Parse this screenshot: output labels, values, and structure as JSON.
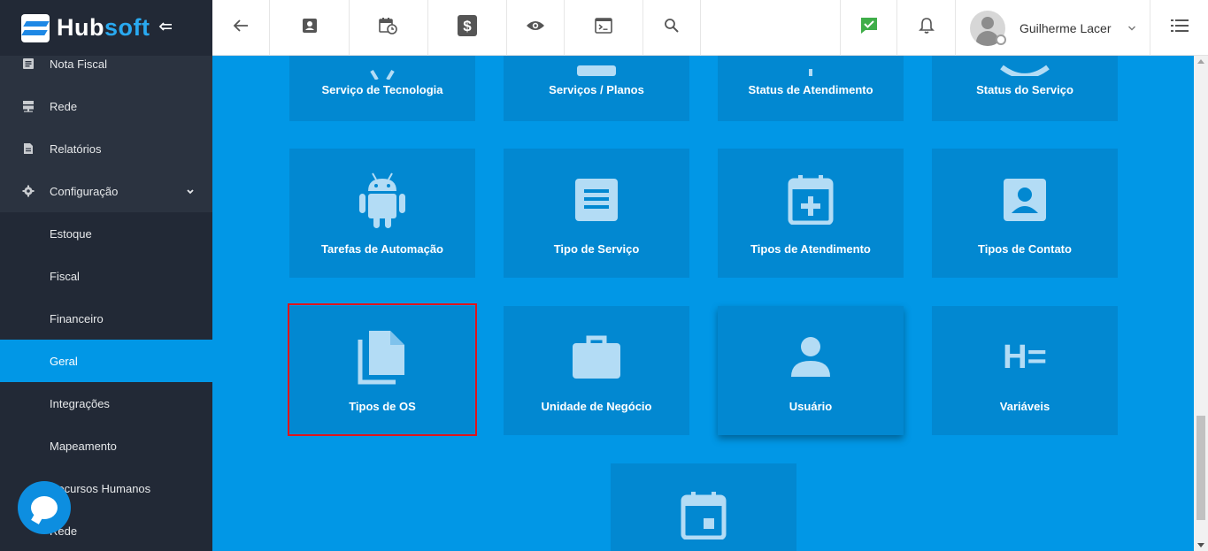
{
  "brand": {
    "name_part1": "Hub",
    "name_part2": "soft"
  },
  "sidebar": {
    "items": [
      {
        "label": "Nota Fiscal",
        "icon": "document-icon"
      },
      {
        "label": "Rede",
        "icon": "server-icon"
      },
      {
        "label": "Relatórios",
        "icon": "file-text-icon"
      },
      {
        "label": "Configuração",
        "icon": "gear-icon",
        "expanded": true
      },
      {
        "label": "Estoque"
      },
      {
        "label": "Fiscal"
      },
      {
        "label": "Financeiro"
      },
      {
        "label": "Geral",
        "active": true
      },
      {
        "label": "Integrações"
      },
      {
        "label": "Mapeamento"
      },
      {
        "label": "Recursos Humanos"
      },
      {
        "label": "Rede"
      }
    ]
  },
  "topbar": {
    "icons": [
      "arrow-left-icon",
      "contact-card-icon",
      "calendar-clock-icon",
      "dollar-icon",
      "eye-icon",
      "terminal-icon",
      "search-icon",
      "chat-check-icon",
      "bell-icon",
      "menu-list-icon"
    ],
    "user_name": "Guilherme Lacer"
  },
  "tiles": [
    {
      "label": "Serviço de Tecnologia",
      "icon": "tech-icon"
    },
    {
      "label": "Serviços / Planos",
      "icon": "plans-icon"
    },
    {
      "label": "Status de Atendimento",
      "icon": "status-icon"
    },
    {
      "label": "Status do Serviço",
      "icon": "status-circle-icon"
    },
    {
      "label": "Tarefas de Automação",
      "icon": "android-icon"
    },
    {
      "label": "Tipo de Serviço",
      "icon": "document-lines-icon"
    },
    {
      "label": "Tipos de Atendimento",
      "icon": "calendar-plus-icon"
    },
    {
      "label": "Tipos de Contato",
      "icon": "contact-card-icon"
    },
    {
      "label": "Tipos de OS",
      "icon": "copy-file-icon"
    },
    {
      "label": "Unidade de Negócio",
      "icon": "briefcase-icon"
    },
    {
      "label": "Usuário",
      "icon": "person-icon"
    },
    {
      "label": "Variáveis",
      "icon": "variables-icon",
      "icon_text": "H="
    },
    {
      "label": "",
      "icon": "calendar-icon"
    }
  ],
  "colors": {
    "accent": "#0197e6",
    "tile": "#0288d1",
    "sidebar": "#2b3340",
    "highlight": "#e0141b"
  }
}
